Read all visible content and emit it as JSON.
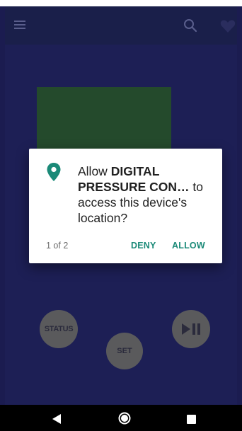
{
  "app": {
    "buttons": {
      "status_label": "STATUS",
      "set_label": "SET",
      "play_pause_icon": "play-pause-icon"
    },
    "icons": [
      "menu-icon",
      "search-icon",
      "heart-icon"
    ]
  },
  "dialog": {
    "icon": "location-pin-icon",
    "message_prefix": "Allow ",
    "app_name": "DIGITAL PRESSURE CON…",
    "message_suffix": " to access this device's location?",
    "page_counter": "1 of 2",
    "deny_label": "DENY",
    "allow_label": "ALLOW",
    "accent_color": "#1b8a78"
  },
  "nav": {
    "icons": [
      "back-icon",
      "home-icon",
      "recents-icon"
    ]
  }
}
